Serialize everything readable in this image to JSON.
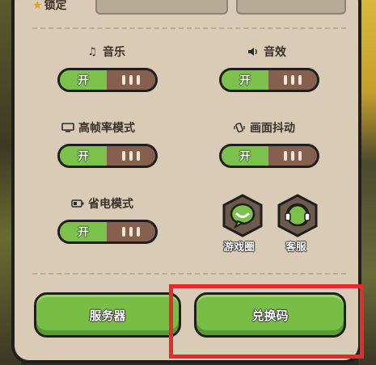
{
  "top": {
    "label": "锁定"
  },
  "settings": {
    "music": {
      "label": "音乐",
      "icon": "music-note-icon",
      "state": "开"
    },
    "sfx": {
      "label": "音效",
      "icon": "speaker-icon",
      "state": "开"
    },
    "high_fps": {
      "label": "高帧率模式",
      "icon": "monitor-icon",
      "state": "开"
    },
    "screen_shake": {
      "label": "画面抖动",
      "icon": "shake-icon",
      "state": "开"
    },
    "power_save": {
      "label": "省电模式",
      "icon": "battery-icon",
      "state": "开"
    }
  },
  "shortcuts": {
    "game_circle": {
      "label": "游戏圈",
      "icon": "chat-bubble-icon"
    },
    "customer_service": {
      "label": "客服",
      "icon": "headset-icon"
    }
  },
  "buttons": {
    "server": "服务器",
    "redeem_code": "兑换码"
  },
  "colors": {
    "panel": "#d9cbb6",
    "toggle_on": "#7cc14b",
    "toggle_knob": "#86604f",
    "button_green": "#78bd46",
    "highlight_red": "#e52b2b"
  }
}
